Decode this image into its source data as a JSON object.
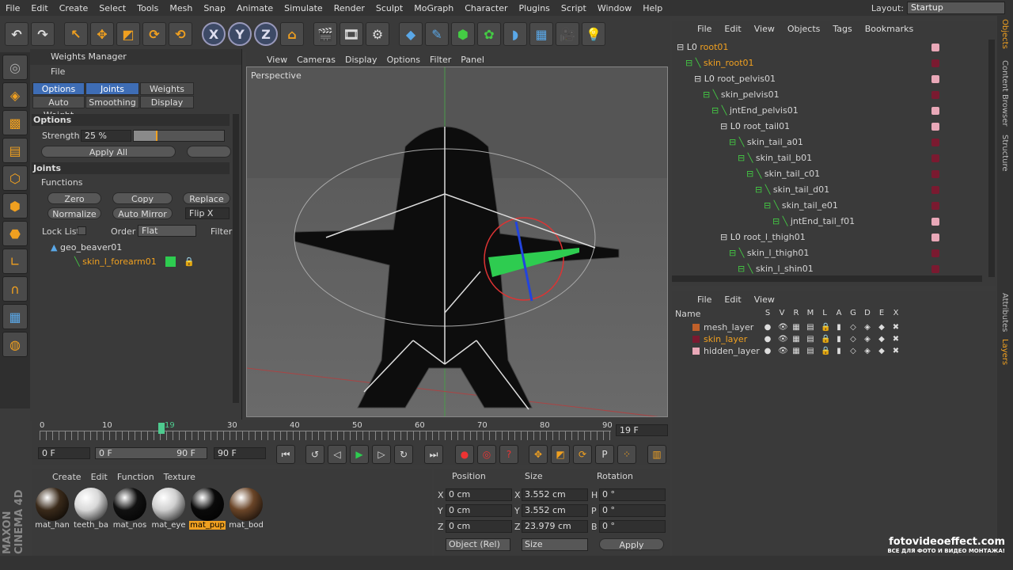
{
  "menu": [
    "File",
    "Edit",
    "Create",
    "Select",
    "Tools",
    "Mesh",
    "Snap",
    "Animate",
    "Simulate",
    "Render",
    "Sculpt",
    "MoGraph",
    "Character",
    "Plugins",
    "Script",
    "Window",
    "Help"
  ],
  "layout_label": "Layout:",
  "layout_value": "Startup",
  "weights": {
    "title": "Weights Manager",
    "file": "File",
    "tabs": [
      "Options",
      "Joints",
      "Weights",
      "Auto Weight",
      "Smoothing",
      "Display"
    ],
    "options_head": "Options",
    "strength_label": "Strength",
    "strength_value": "25 %",
    "apply_all": "Apply All",
    "joints_head": "Joints",
    "functions": "Functions",
    "zero": "Zero",
    "copy": "Copy",
    "replace": "Replace",
    "normalize": "Normalize",
    "auto_mirror": "Auto Mirror",
    "flip": "Flip X",
    "lock_list": "Lock List",
    "order_label": "Order",
    "order_value": "Flat",
    "filter": "Filter",
    "tree": [
      "geo_beaver01",
      "skin_l_forearm01"
    ]
  },
  "viewport": {
    "menu": [
      "View",
      "Cameras",
      "Display",
      "Options",
      "Filter",
      "Panel"
    ],
    "label": "Perspective"
  },
  "timeline": {
    "ticks": [
      "0",
      "10",
      "19",
      "30",
      "40",
      "50",
      "60",
      "70",
      "80",
      "90"
    ],
    "frame": "19 F"
  },
  "transport": {
    "start": "0 F",
    "min": "0 F",
    "max": "90 F",
    "end": "90 F"
  },
  "materials": {
    "menu": [
      "Create",
      "Edit",
      "Function",
      "Texture"
    ],
    "items": [
      {
        "name": "mat_han",
        "color": "#3a2a1a"
      },
      {
        "name": "teeth_ba",
        "color": "#d8d8d8"
      },
      {
        "name": "mat_nos",
        "color": "#111111"
      },
      {
        "name": "mat_eye",
        "color": "#cfcfcf"
      },
      {
        "name": "mat_pup",
        "color": "#0a0a0a"
      },
      {
        "name": "mat_bod",
        "color": "#6a4528"
      }
    ]
  },
  "coords": {
    "position": "Position",
    "size": "Size",
    "rotation": "Rotation",
    "px": "0 cm",
    "py": "0 cm",
    "pz": "0 cm",
    "sx": "3.552 cm",
    "sy": "3.552 cm",
    "sz": "23.979 cm",
    "rh": "0 °",
    "rp": "0 °",
    "rb": "0 °",
    "labels": [
      "X",
      "Y",
      "Z",
      "X",
      "Y",
      "Z",
      "H",
      "P",
      "B"
    ],
    "mode": "Object (Rel)",
    "mode2": "Size",
    "apply": "Apply"
  },
  "objects": {
    "menu": [
      "File",
      "Edit",
      "View",
      "Objects",
      "Tags",
      "Bookmarks"
    ],
    "rows": [
      {
        "name": "root01",
        "indent": 0,
        "type": "root",
        "color": "#e9a8b8",
        "orange": true
      },
      {
        "name": "skin_root01",
        "indent": 1,
        "type": "skin",
        "color": "#7a1a30",
        "orange": true
      },
      {
        "name": "root_pelvis01",
        "indent": 2,
        "type": "root",
        "color": "#e9a8b8"
      },
      {
        "name": "skin_pelvis01",
        "indent": 3,
        "type": "skin",
        "color": "#7a1a30"
      },
      {
        "name": "jntEnd_pelvis01",
        "indent": 4,
        "type": "skin",
        "color": "#e9a8b8"
      },
      {
        "name": "root_tail01",
        "indent": 5,
        "type": "root",
        "color": "#e9a8b8"
      },
      {
        "name": "skin_tail_a01",
        "indent": 6,
        "type": "skin",
        "color": "#7a1a30"
      },
      {
        "name": "skin_tail_b01",
        "indent": 7,
        "type": "skin",
        "color": "#7a1a30"
      },
      {
        "name": "skin_tail_c01",
        "indent": 8,
        "type": "skin",
        "color": "#7a1a30"
      },
      {
        "name": "skin_tail_d01",
        "indent": 9,
        "type": "skin",
        "color": "#7a1a30"
      },
      {
        "name": "skin_tail_e01",
        "indent": 10,
        "type": "skin",
        "color": "#7a1a30"
      },
      {
        "name": "jntEnd_tail_f01",
        "indent": 11,
        "type": "skin",
        "color": "#e9a8b8"
      },
      {
        "name": "root_l_thigh01",
        "indent": 5,
        "type": "root",
        "color": "#e9a8b8"
      },
      {
        "name": "skin_l_thigh01",
        "indent": 6,
        "type": "skin",
        "color": "#7a1a30"
      },
      {
        "name": "skin_l_shin01",
        "indent": 7,
        "type": "skin",
        "color": "#7a1a30"
      }
    ]
  },
  "layers": {
    "menu": [
      "File",
      "Edit",
      "View"
    ],
    "name_col": "Name",
    "cols": [
      "S",
      "V",
      "R",
      "M",
      "L",
      "A",
      "G",
      "D",
      "E",
      "X"
    ],
    "rows": [
      {
        "name": "mesh_layer",
        "color": "#c0602a"
      },
      {
        "name": "skin_layer",
        "color": "#7a1a30",
        "active": true
      },
      {
        "name": "hidden_layer",
        "color": "#e9a8b8"
      }
    ]
  },
  "sidetabs": [
    "Objects",
    "Content Browser",
    "Structure",
    "Attributes",
    "Layers"
  ],
  "brand": "MAXON CINEMA 4D",
  "watermark": {
    "line1": "fotovideoeffect.com",
    "line2": "ВСЕ ДЛЯ ФОТО И ВИДЕО МОНТАЖА!"
  }
}
